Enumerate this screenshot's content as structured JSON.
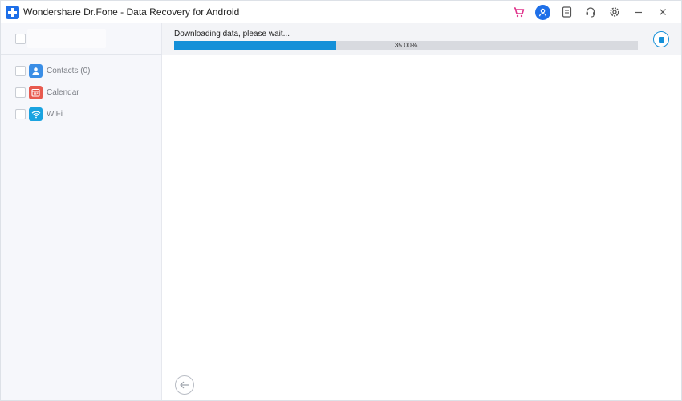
{
  "window": {
    "title": "Wondershare Dr.Fone - Data Recovery for Android"
  },
  "titlebar": {
    "icons": [
      "cart-icon",
      "account-icon",
      "feedback-icon",
      "support-icon",
      "settings-icon",
      "minimize-icon",
      "close-icon"
    ]
  },
  "sidebar": {
    "items": [
      {
        "label": "Contacts (0)",
        "icon": "contacts-icon",
        "color": "#3a8ee6"
      },
      {
        "label": "Calendar",
        "icon": "calendar-icon",
        "color": "#e85a4f"
      },
      {
        "label": "WiFi",
        "icon": "wifi-icon",
        "color": "#1aa3e0"
      }
    ]
  },
  "progress": {
    "message": "Downloading data, please wait...",
    "percent_text": "35.00%",
    "fraction": 0.35
  },
  "colors": {
    "accent": "#1590d8",
    "brand": "#1e6fe8"
  }
}
